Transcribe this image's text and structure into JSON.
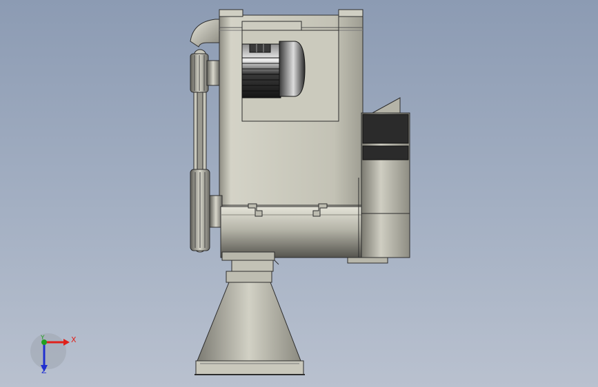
{
  "viewport": {
    "background_top": "#8c9bb3",
    "background_bottom": "#b9c1cf"
  },
  "model": {
    "view": "front",
    "body_color": "#c9c8bb",
    "shadow_color": "#6e6d66",
    "motor_color": "#2a2a2a",
    "dark_panel_color": "#2b2b2b"
  },
  "triad": {
    "x_label": "X",
    "y_label": "Y",
    "z_label": "Z",
    "x_color": "#e0201a",
    "y_color": "#20a020",
    "z_color": "#2030d0"
  }
}
